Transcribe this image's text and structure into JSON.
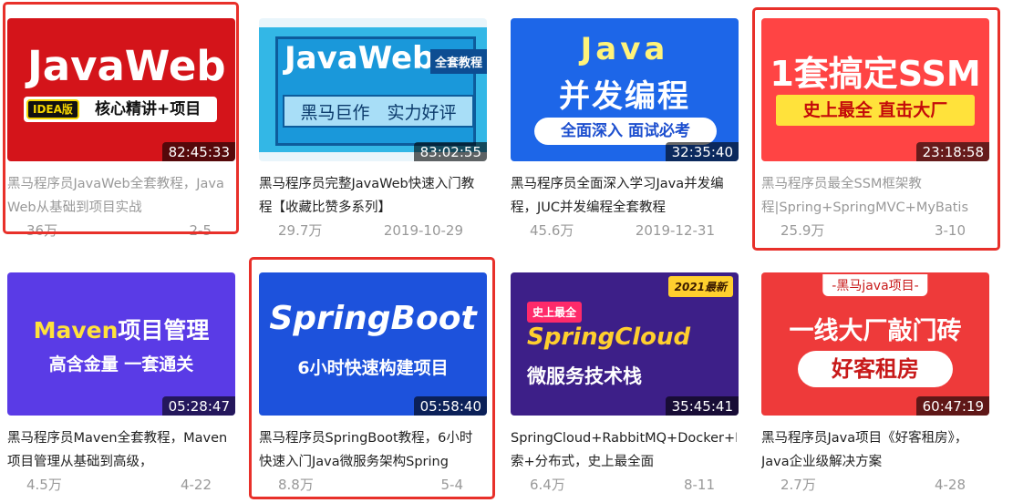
{
  "videos": [
    {
      "thumb": {
        "main": "JavaWeb",
        "tag": "IDEA版",
        "sub": "核心精讲+项目"
      },
      "duration": "82:45:33",
      "title": "黑马程序员JavaWeb全套教程，Java Web从基础到项目实战",
      "views": "36万",
      "date": "2-5",
      "highlighted": true
    },
    {
      "thumb": {
        "main": "JavaWeb",
        "badge": "全套教程",
        "sub": "黑马巨作　实力好评"
      },
      "duration": "83:02:55",
      "title": "黑马程序员完整JavaWeb快速入门教程【收藏比赞多系列】",
      "views": "29.7万",
      "date": "2019-10-29",
      "highlighted": false
    },
    {
      "thumb": {
        "main": "Java",
        "main2": "并发编程",
        "sub": "全面深入 面试必考"
      },
      "duration": "32:35:40",
      "title": "黑马程序员全面深入学习Java并发编程，JUC并发编程全套教程",
      "views": "45.6万",
      "date": "2019-12-31",
      "highlighted": false
    },
    {
      "thumb": {
        "main": "1套搞定SSM",
        "sub": "史上最全 直击大厂"
      },
      "duration": "23:18:58",
      "title": "黑马程序员最全SSM框架教程|Spring+SpringMVC+MyBatis",
      "views": "25.9万",
      "date": "3-10",
      "highlighted": true
    },
    {
      "thumb": {
        "main_a": "Maven",
        "main_b": "项目管理",
        "sub": "高含金量 一套通关"
      },
      "duration": "05:28:47",
      "title": "黑马程序员Maven全套教程，Maven项目管理从基础到高级，",
      "views": "4.5万",
      "date": "4-22",
      "highlighted": false
    },
    {
      "thumb": {
        "main": "SpringBoot",
        "sub": "6小时快速构建项目"
      },
      "duration": "05:58:40",
      "title": "黑马程序员SpringBoot教程，6小时快速入门Java微服务架构Spring",
      "views": "8.8万",
      "date": "5-4",
      "highlighted": true
    },
    {
      "thumb": {
        "new": "2021最新",
        "tag": "史上最全",
        "main": "SpringCloud",
        "sub": "微服务技术栈"
      },
      "duration": "35:45:41",
      "title": "SpringCloud+RabbitMQ+Docker+Redis+搜索+分布式，史上最全面",
      "views": "6.4万",
      "date": "8-11",
      "highlighted": false
    },
    {
      "thumb": {
        "top": "-黑马java项目-",
        "main": "一线大厂敲门砖",
        "sub": "好客租房"
      },
      "duration": "60:47:19",
      "title": "黑马程序员Java项目《好客租房》，Java企业级解决方案",
      "views": "2.7万",
      "date": "4-28",
      "highlighted": false
    }
  ],
  "colors": {
    "highlight": "#e8302a",
    "meta": "#999999"
  }
}
